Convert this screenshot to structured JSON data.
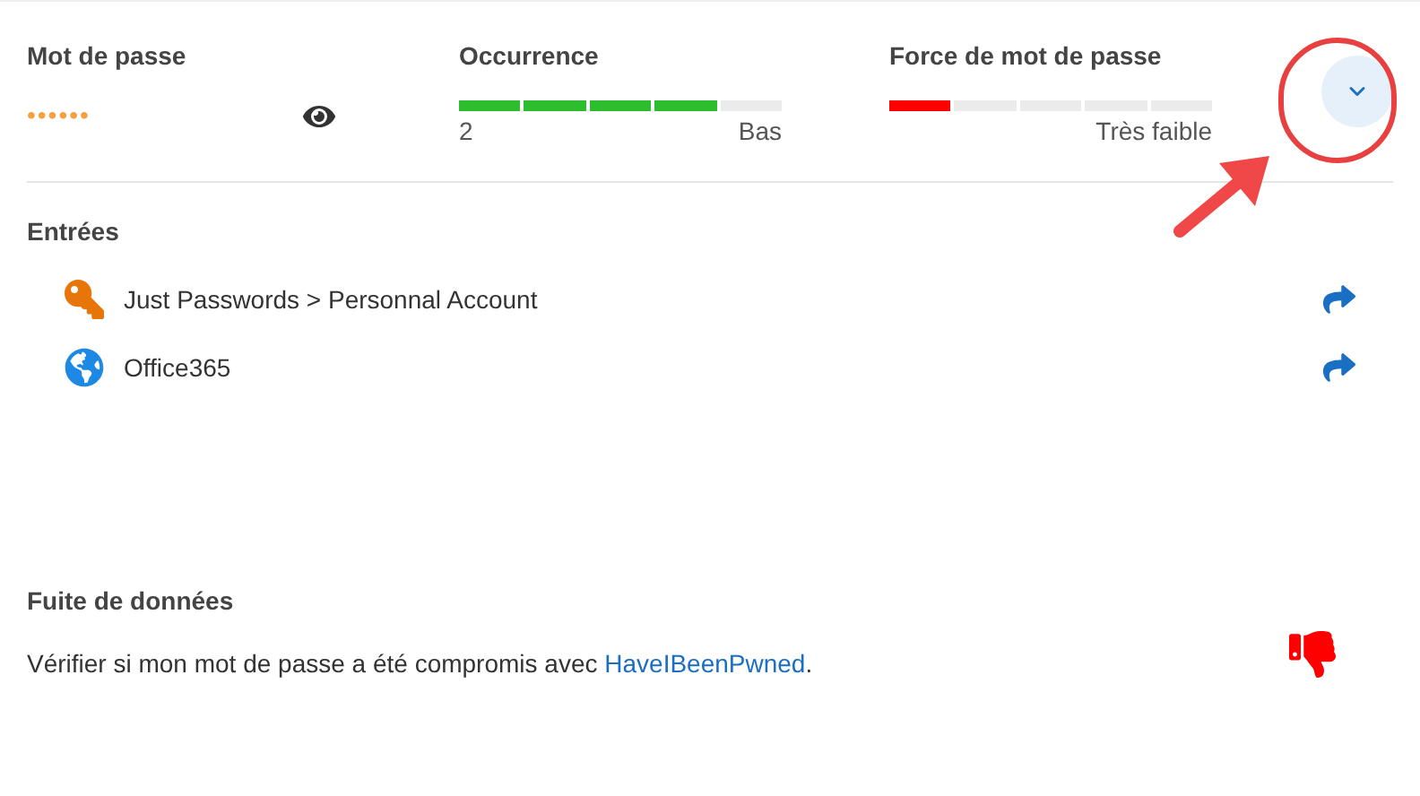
{
  "password": {
    "label": "Mot de passe",
    "value": "••••••"
  },
  "occurrence": {
    "label": "Occurrence",
    "level": 0.8,
    "count": "2",
    "rating": "Bas"
  },
  "strength": {
    "label": "Force de mot de passe",
    "level": 0.2,
    "rating": "Très faible"
  },
  "entries": {
    "title": "Entrées",
    "items": [
      {
        "kind": "key",
        "label": "Just Passwords > Personnal Account"
      },
      {
        "kind": "web",
        "label": "Office365"
      }
    ]
  },
  "breach": {
    "title": "Fuite de données",
    "text": "Vérifier si mon mot de passe a été compromis avec ",
    "link": "HaveIBeenPwned",
    "after": "."
  }
}
